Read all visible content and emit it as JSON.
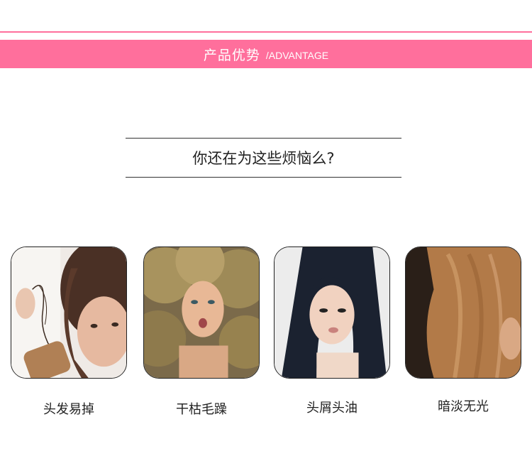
{
  "header": {
    "title_cn": "产品优势",
    "title_en": "/ADVANTAGE"
  },
  "question": "你还在为这些烦恼么?",
  "problems": [
    {
      "label": "头发易掉"
    },
    {
      "label": "干枯毛躁"
    },
    {
      "label": "头屑头油"
    },
    {
      "label": "暗淡无光"
    }
  ],
  "colors": {
    "accent": "#ff6f9c",
    "text": "#222222"
  }
}
